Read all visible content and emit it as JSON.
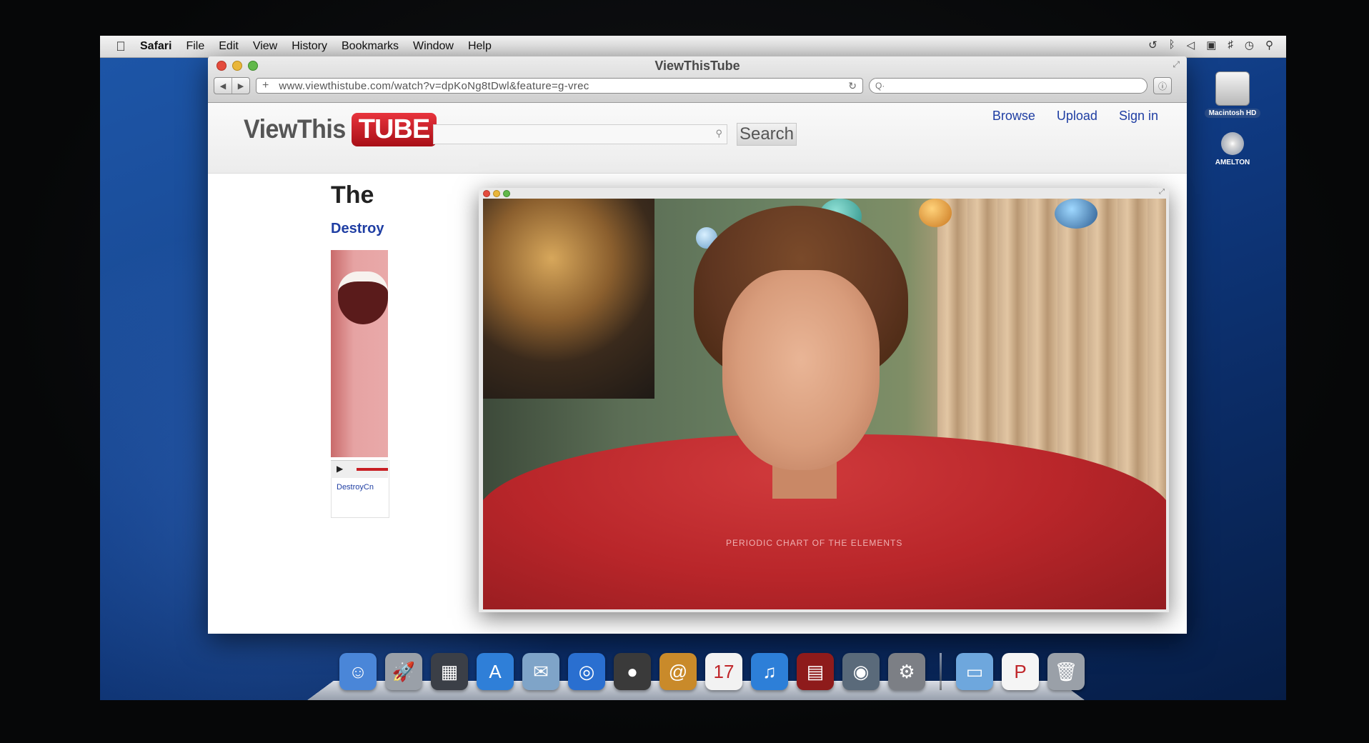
{
  "menubar": {
    "apple": "",
    "app_name": "Safari",
    "items": [
      "File",
      "Edit",
      "View",
      "History",
      "Bookmarks",
      "Window",
      "Help"
    ],
    "status_icons": [
      "time-machine-icon",
      "bluetooth-icon",
      "wifi-icon",
      "display-icon",
      "volume-icon",
      "clock-icon",
      "spotlight-icon"
    ]
  },
  "desktop": {
    "icons": [
      {
        "label": "Macintosh HD",
        "icon": "hard-drive-icon"
      },
      {
        "label": "AMELTON",
        "icon": "disc-icon"
      }
    ]
  },
  "window": {
    "title": "ViewThisTube",
    "url": "www.viewthistube.com/watch?v=dpKoNg8tDwl&feature=g-vrec",
    "url_plus": "+",
    "search_glyph": "Q·"
  },
  "site": {
    "logo_view": "ViewThis",
    "logo_tube": "TUBE",
    "search_button": "Search",
    "links": [
      "Browse",
      "Upload",
      "Sign in"
    ],
    "video_title": "The",
    "channel": "Destroy",
    "thumb_caption": "DestroyCn",
    "play_glyph": "▶"
  },
  "video": {
    "shirt_text": "PERIODIC CHART OF THE ELEMENTS"
  },
  "dock": {
    "apps": [
      {
        "name": "finder-icon",
        "color": "#4a86d8",
        "glyph": "☺"
      },
      {
        "name": "launchpad-icon",
        "color": "#9aa0a8",
        "glyph": "🚀"
      },
      {
        "name": "mission-control-icon",
        "color": "#3b3f47",
        "glyph": "▦"
      },
      {
        "name": "app-store-icon",
        "color": "#2f7fd8",
        "glyph": "A"
      },
      {
        "name": "mail-icon",
        "color": "#7fa4c8",
        "glyph": "✉"
      },
      {
        "name": "safari-icon",
        "color": "#2a6fd0",
        "glyph": "◎"
      },
      {
        "name": "facetime-icon",
        "color": "#3a3a3a",
        "glyph": "●"
      },
      {
        "name": "address-book-icon",
        "color": "#c98a2a",
        "glyph": "@"
      },
      {
        "name": "ical-icon",
        "color": "#f2f2f2",
        "glyph": "17"
      },
      {
        "name": "itunes-icon",
        "color": "#2d7fd8",
        "glyph": "♫"
      },
      {
        "name": "photo-booth-icon",
        "color": "#8e1b1b",
        "glyph": "▤"
      },
      {
        "name": "iphoto-icon",
        "color": "#5a6a7a",
        "glyph": "◉"
      },
      {
        "name": "system-preferences-icon",
        "color": "#7c7f85",
        "glyph": "⚙"
      }
    ],
    "stack": [
      {
        "name": "folder-icon",
        "color": "#6ea7dd",
        "glyph": "▭"
      },
      {
        "name": "pages-document-icon",
        "color": "#f5f5f5",
        "glyph": "P"
      },
      {
        "name": "trash-icon",
        "color": "#9aa0a8",
        "glyph": "🗑"
      }
    ]
  }
}
